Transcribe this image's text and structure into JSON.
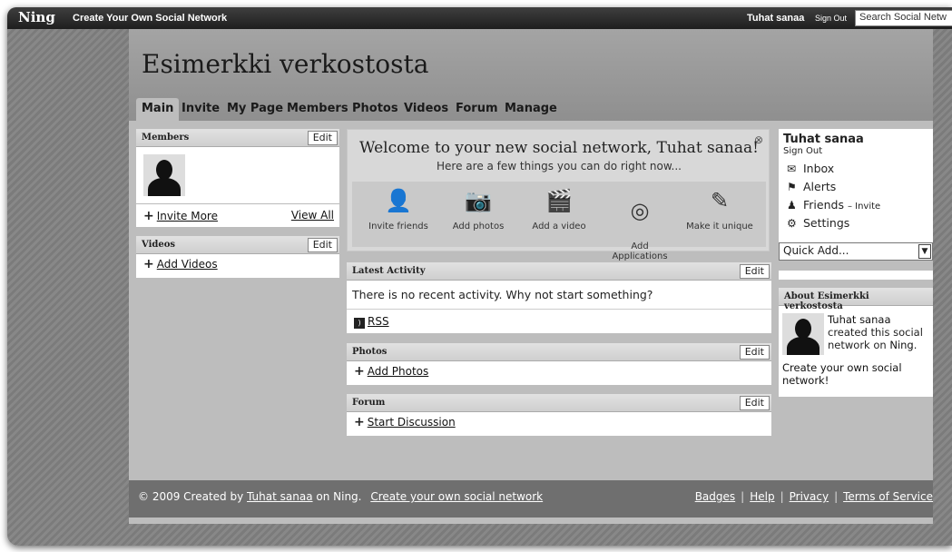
{
  "topbar": {
    "logo": "Ning",
    "create_network": "Create Your Own Social Network",
    "user_name": "Tuhat sanaa",
    "sign_out": "Sign Out",
    "search_placeholder": "Search Social Netw"
  },
  "site": {
    "title": "Esimerkki verkostosta"
  },
  "nav": [
    "Main",
    "Invite",
    "My Page",
    "Members",
    "Photos",
    "Videos",
    "Forum",
    "Manage"
  ],
  "members": {
    "title": "Members",
    "edit": "Edit",
    "invite_more": "Invite More",
    "view_all": "View All"
  },
  "videos": {
    "title": "Videos",
    "edit": "Edit",
    "add": "Add Videos"
  },
  "welcome": {
    "title": "Welcome to your new social network, Tuhat sanaa!",
    "subtitle": "Here are a few things you can do right now...",
    "close": "⊗",
    "actions": [
      {
        "label": "Invite friends",
        "icon": "invite-friends-icon",
        "glyph": "👤"
      },
      {
        "label": "Add photos",
        "icon": "camera-icon",
        "glyph": "📷"
      },
      {
        "label": "Add a video",
        "icon": "clapperboard-icon",
        "glyph": "🎬"
      },
      {
        "label": "Add\nApplications",
        "icon": "applications-icon",
        "glyph": "◎"
      },
      {
        "label": "Make it unique",
        "icon": "magic-wand-icon",
        "glyph": "✎"
      }
    ]
  },
  "latest_activity": {
    "title": "Latest Activity",
    "edit": "Edit",
    "message": "There is no recent activity. Why not start something?",
    "rss": "RSS"
  },
  "photos": {
    "title": "Photos",
    "edit": "Edit",
    "add": "Add Photos"
  },
  "forum": {
    "title": "Forum",
    "edit": "Edit",
    "add": "Start Discussion"
  },
  "user_box": {
    "name": "Tuhat sanaa",
    "sign_out": "Sign Out",
    "inbox": "Inbox",
    "alerts": "Alerts",
    "friends": "Friends",
    "friends_invite": "– Invite",
    "settings": "Settings",
    "quick_add": "Quick Add..."
  },
  "about": {
    "title": "About Esimerkki verkostosta",
    "creator_link": "Tuhat sanaa",
    "created_text": "created this social network on",
    "ning_link": "Ning",
    "create_own": "Create your own social network!"
  },
  "footer": {
    "copyright": "© 2009  Created by",
    "creator": "Tuhat sanaa",
    "on_ning": "on Ning.",
    "create_own": "Create your own social network",
    "links": [
      "Badges",
      "Help",
      "Privacy",
      "Terms of Service"
    ]
  },
  "colors": {
    "topbar": "#2b2b2b",
    "page_bg": "#bdbdbd",
    "header_bg": "#9a9a9a",
    "footer_bg": "#6f6f6f"
  }
}
